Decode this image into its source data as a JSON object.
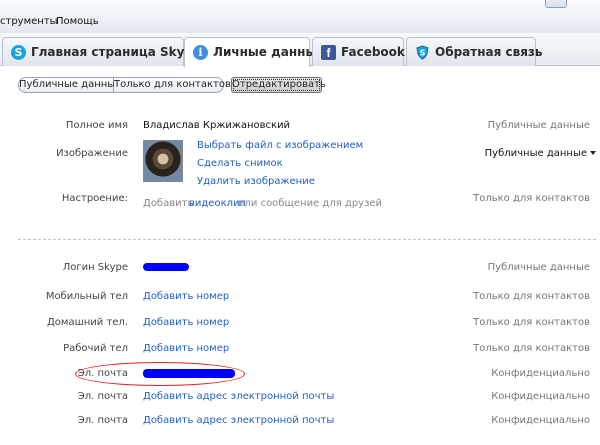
{
  "menubar": {
    "items": [
      "струменты",
      "Помощь"
    ]
  },
  "tabs": [
    {
      "label": "Главная страница Skype",
      "icon": "skype-icon"
    },
    {
      "label": "Личные данные",
      "icon": "info-icon",
      "active": true
    },
    {
      "label": "Facebook",
      "icon": "facebook-icon"
    },
    {
      "label": "Обратная связь",
      "icon": "shield-icon"
    }
  ],
  "filters": {
    "public": "Публичные данные",
    "contacts": "Только для контактов",
    "edit": "Отредактировать"
  },
  "profile": {
    "full_name": {
      "label": "Полное имя",
      "value": "Владислав Кржижановский",
      "privacy": "Публичные данные"
    },
    "picture": {
      "label": "Изображение",
      "choose_file": "Выбрать файл с изображением",
      "take_snapshot": "Сделать снимок",
      "remove": "Удалить изображение",
      "privacy": "Публичные данные"
    },
    "mood": {
      "label": "Настроение:",
      "pre": "Добавить",
      "link": "видеоклип",
      "post": "или сообщение для друзей",
      "privacy": "Только для контактов"
    }
  },
  "contacts": {
    "skype_login": {
      "label": "Логин Skype",
      "privacy": "Публичные данные"
    },
    "mobile": {
      "label": "Мобильный тел",
      "action": "Добавить номер",
      "privacy": "Только для контактов"
    },
    "home": {
      "label": "Домашний тел.",
      "action": "Добавить номер",
      "privacy": "Только для контактов"
    },
    "office": {
      "label": "Рабочий тел",
      "action": "Добавить номер",
      "privacy": "Только для контактов"
    },
    "email1": {
      "label": "Эл. почта",
      "privacy": "Конфиденциально"
    },
    "email2": {
      "label": "Эл. почта",
      "action": "Добавить адрес электронной почты",
      "privacy": "Конфиденциально"
    },
    "email3": {
      "label": "Эл. почта",
      "action": "Добавить адрес электронной почты",
      "privacy": "Конфиденциально"
    }
  },
  "colors": {
    "link": "#1f5fc6",
    "redaction": "#0000ff",
    "annotation": "#e02020"
  }
}
